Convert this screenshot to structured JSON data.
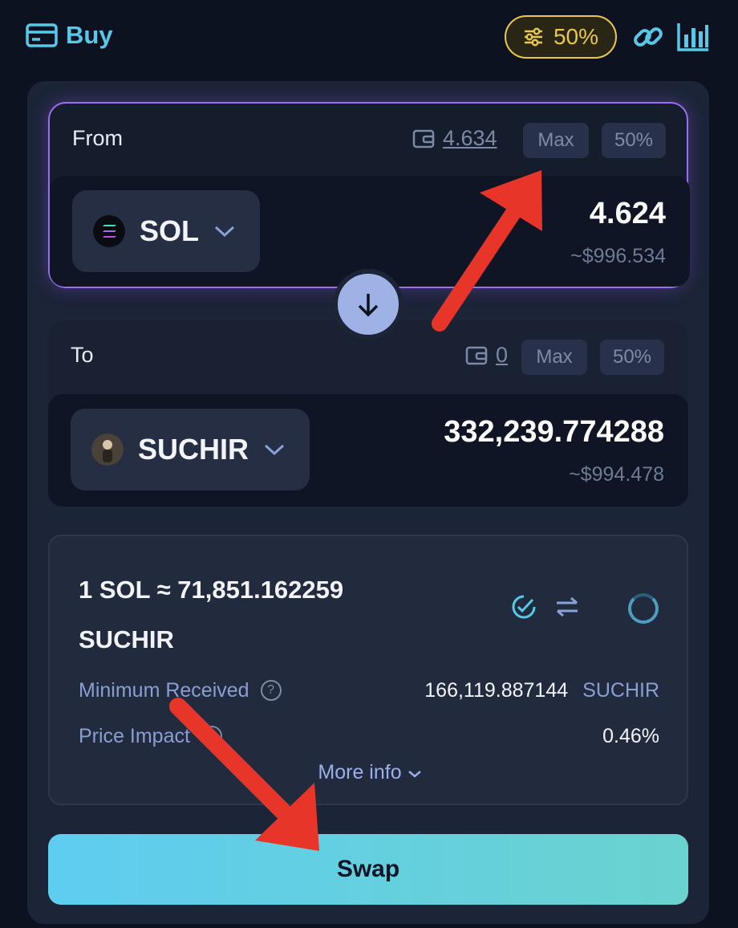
{
  "header": {
    "buy_label": "Buy",
    "slippage_label": "50%"
  },
  "from": {
    "label": "From",
    "balance": "4.634",
    "max_label": "Max",
    "half_label": "50%",
    "token": "SOL",
    "amount": "4.624",
    "usd_value": "~$996.534"
  },
  "to": {
    "label": "To",
    "balance": "0",
    "max_label": "Max",
    "half_label": "50%",
    "token": "SUCHIR",
    "amount": "332,239.774288",
    "usd_value": "~$994.478"
  },
  "info": {
    "rate": "1 SOL ≈ 71,851.162259 SUCHIR",
    "min_received_label": "Minimum Received",
    "min_received_value": "166,119.887144",
    "min_received_unit": "SUCHIR",
    "price_impact_label": "Price Impact",
    "price_impact_value": "0.46%",
    "more_info_label": "More info"
  },
  "swap_label": "Swap",
  "colors": {
    "accent": "#58c8e8",
    "slippage": "#e8c84a",
    "from_border": "#9a6ef0",
    "annotation_arrow": "#e8352a"
  }
}
